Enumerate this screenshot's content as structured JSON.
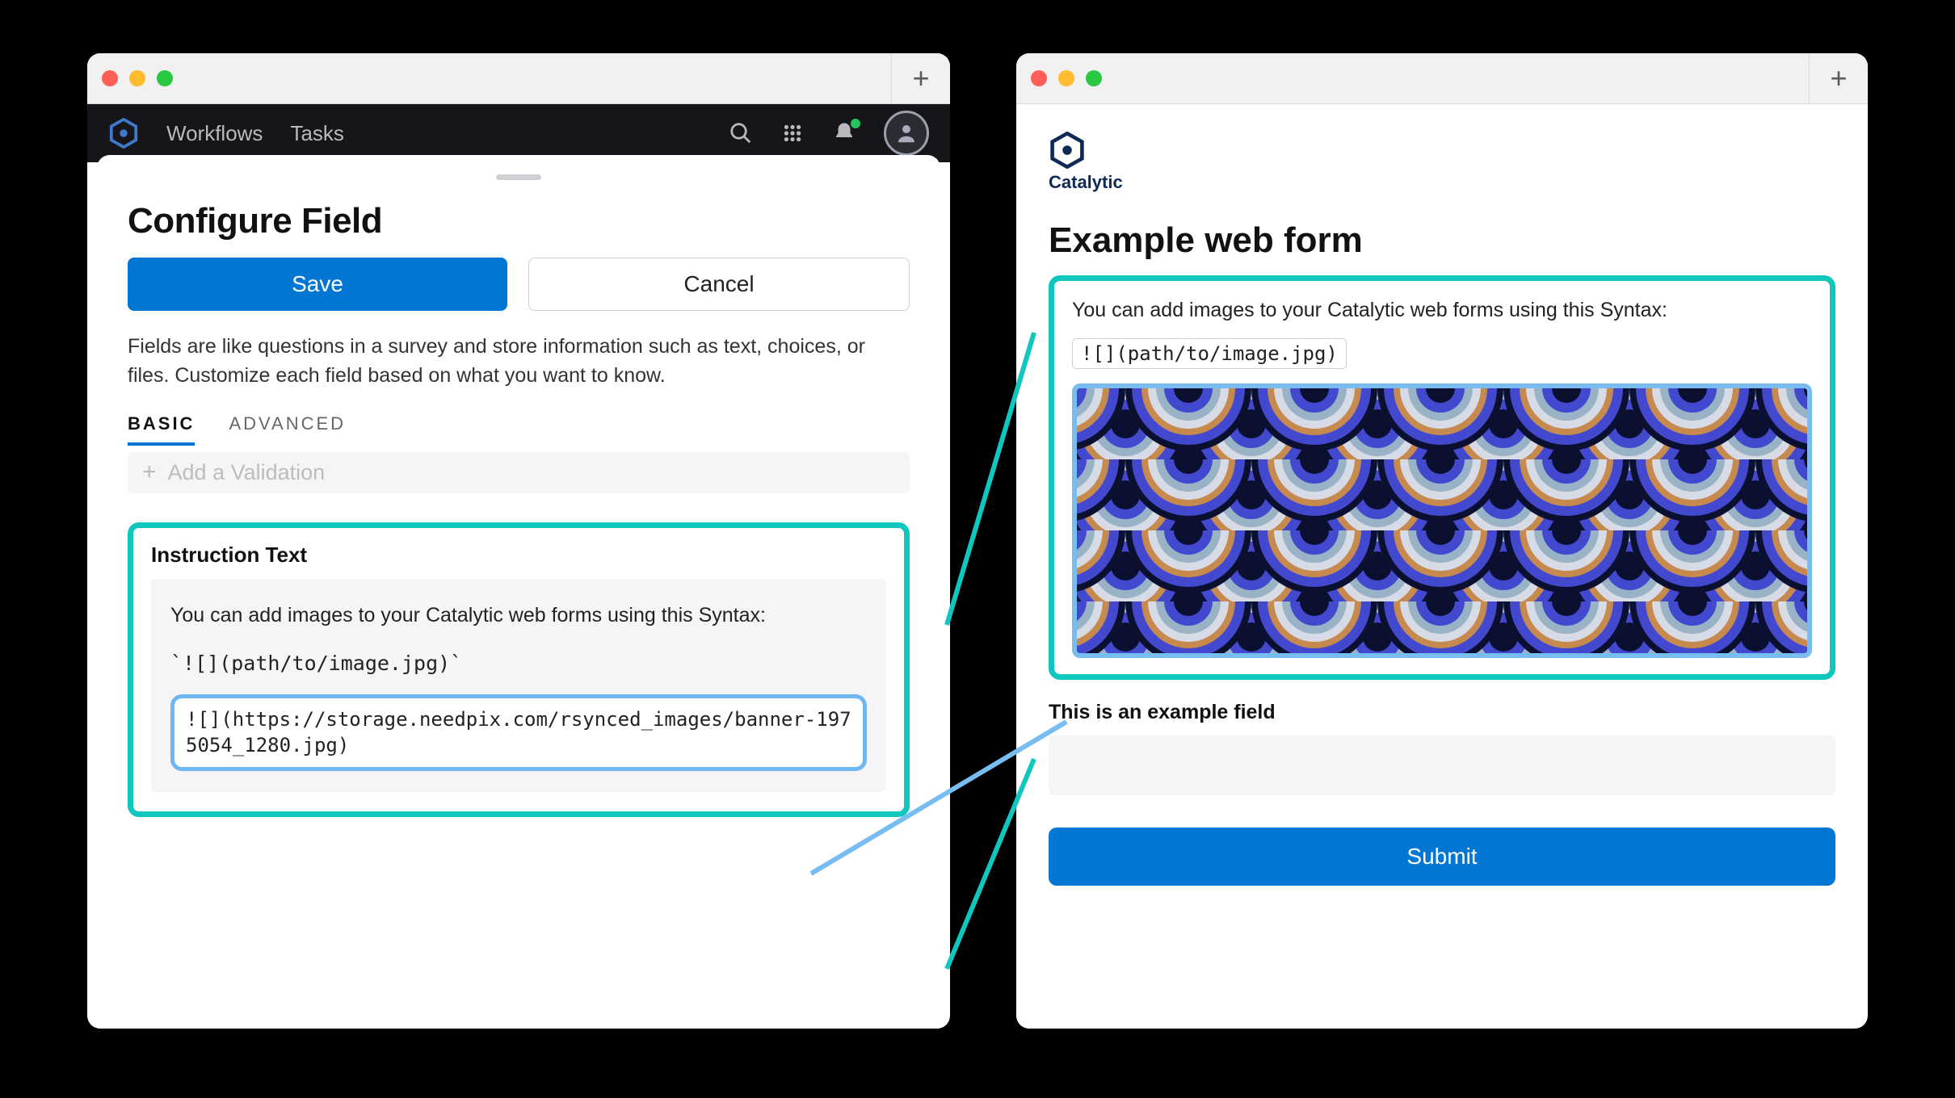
{
  "left": {
    "nav": {
      "item1": "Workflows",
      "item2": "Tasks"
    },
    "title": "Configure Field",
    "save": "Save",
    "cancel": "Cancel",
    "description": "Fields are like questions in a survey and store information such as text, choices, or files. Customize each field based on what you want to know.",
    "tabs": {
      "basic": "BASIC",
      "advanced": "ADVANCED"
    },
    "add_validation": "Add a Validation",
    "instruction": {
      "label": "Instruction Text",
      "line1": "You can add images to your Catalytic web forms using this Syntax:",
      "line2": "`![](path/to/image.jpg)`",
      "line3": "![](https://storage.needpix.com/rsynced_images/banner-1975054_1280.jpg)"
    }
  },
  "right": {
    "brand": "Catalytic",
    "title": "Example web form",
    "note": "You can add images to your Catalytic web forms using this Syntax:",
    "code": "![](path/to/image.jpg)",
    "field_label": "This is an example field",
    "submit": "Submit"
  },
  "colors": {
    "accent": "#0176d3",
    "teal": "#10c7bd",
    "skyborder": "#78bdf1"
  }
}
